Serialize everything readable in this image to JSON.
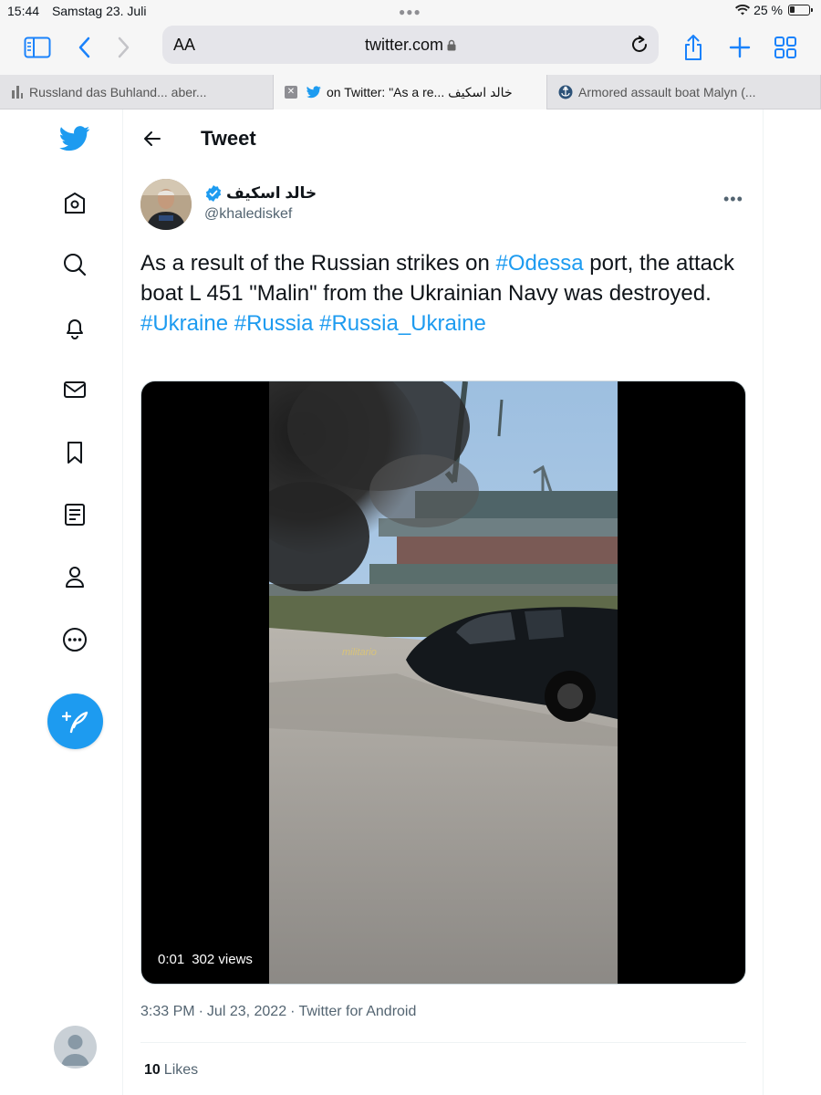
{
  "status_bar": {
    "time": "15:44",
    "date": "Samstag 23. Juli",
    "battery": "25 %"
  },
  "browser": {
    "text_size_label": "AA",
    "url": "twitter.com",
    "tabs": [
      {
        "label": "Russland das Buhland... aber...",
        "active": false
      },
      {
        "label": "on Twitter: \"As a re... خالد اسكيف",
        "active": true
      },
      {
        "label": "Armored assault boat Malyn (...",
        "active": false
      }
    ]
  },
  "nav": {
    "icons": [
      "twitter-logo-icon",
      "home-icon",
      "explore-icon",
      "notifications-icon",
      "messages-icon",
      "bookmarks-icon",
      "lists-icon",
      "profile-icon",
      "more-icon",
      "compose-tweet-icon"
    ]
  },
  "header": {
    "title": "Tweet"
  },
  "tweet": {
    "author_name": "خالد اسكيف",
    "author_handle": "@khalediskef",
    "text_before": "As a result of the Russian strikes on ",
    "hashtag_odessa": "#Odessa",
    "text_after": " port, the attack boat L 451 \"Malin\" from the Ukrainian Navy was destroyed.",
    "hashtags": [
      "#Ukraine",
      "#Russia",
      "#Russia_Ukraine"
    ],
    "video": {
      "time": "0:01",
      "views": "302 views",
      "watermark": "militario"
    },
    "time": "3:33 PM",
    "date": "Jul 23, 2022",
    "source": "Twitter for Android",
    "likes_count": "10",
    "likes_label": "Likes"
  },
  "colors": {
    "accent": "#1d9bf0",
    "text": "#0f1419",
    "secondary": "#536471"
  }
}
